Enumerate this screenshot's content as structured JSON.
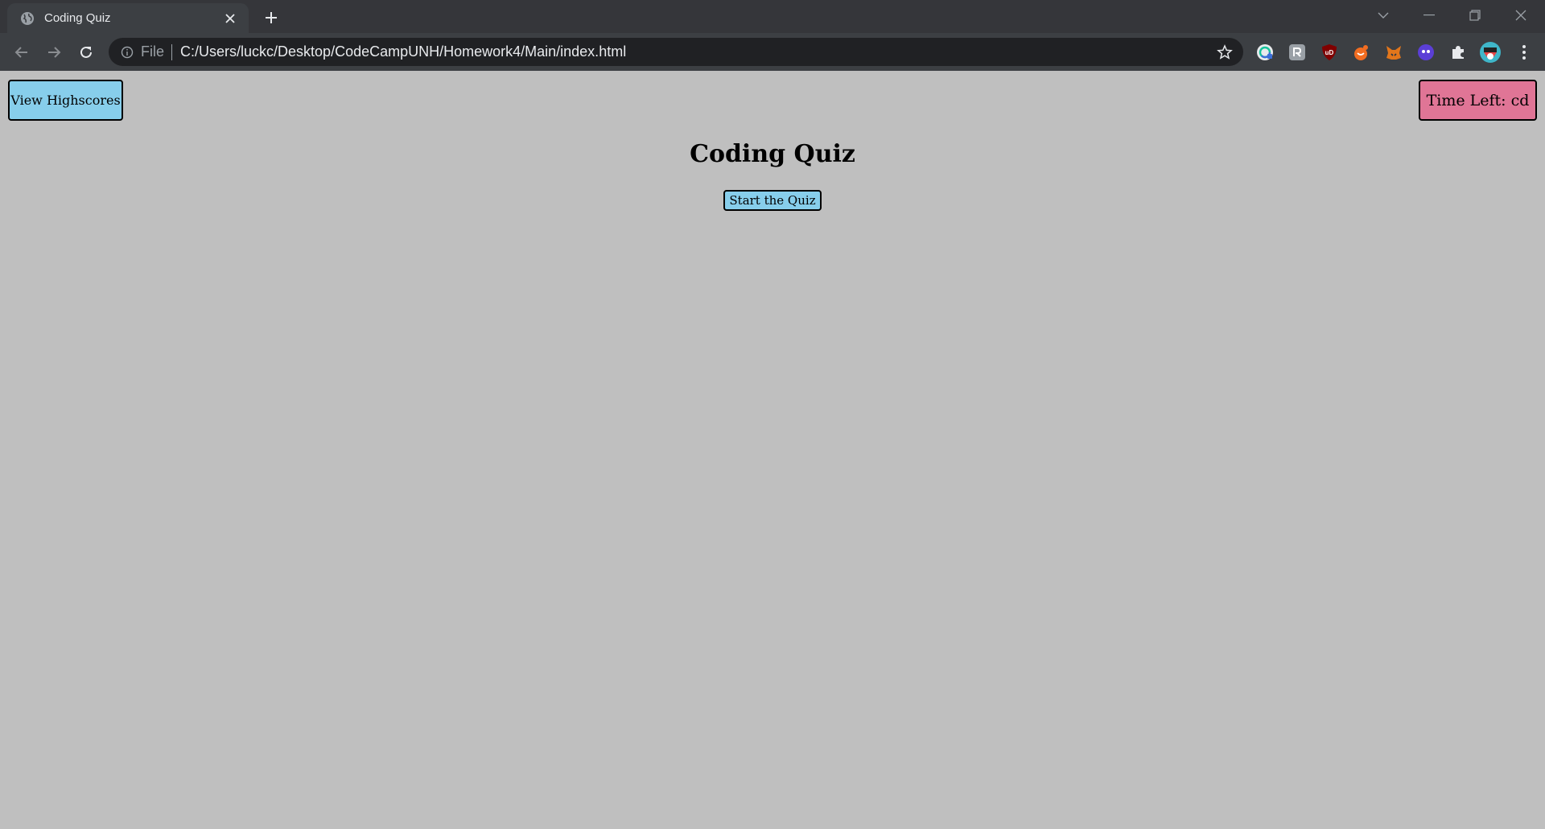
{
  "browser": {
    "tab": {
      "title": "Coding Quiz"
    },
    "address_bar": {
      "scheme_label": "File",
      "url": "C:/Users/luckc/Desktop/CodeCampUNH/Homework4/Main/index.html"
    },
    "extensions": [
      "grammarly-icon",
      "extension-a-icon",
      "ublock-icon",
      "extension-b-icon",
      "metamask-icon",
      "extension-c-icon",
      "puzzle-icon",
      "profile-avatar"
    ]
  },
  "page": {
    "highscores_label": "View Highscores",
    "timer_text": "Time Left: cd",
    "title": "Coding Quiz",
    "start_label": "Start the Quiz"
  },
  "colors": {
    "page_bg": "#bfbfbf",
    "button_blue": "#87ceeb",
    "timer_pink": "#e07596"
  }
}
